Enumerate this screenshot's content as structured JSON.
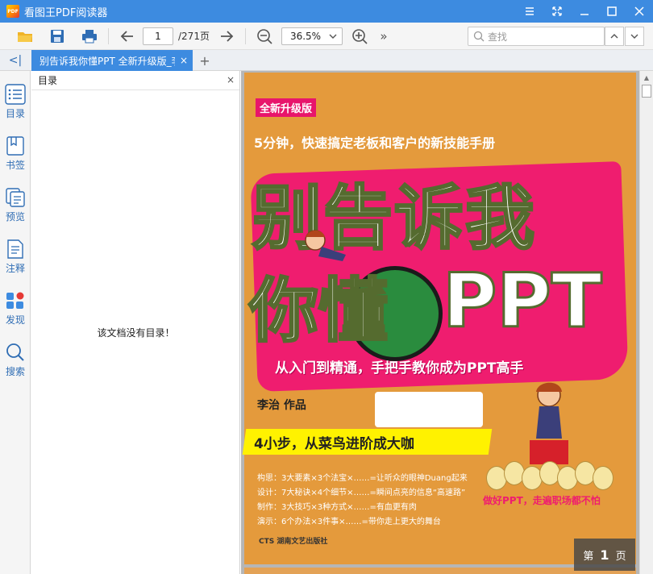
{
  "app": {
    "title": "看图王PDF阅读器",
    "logo_text": "PDF",
    "accent_color": "#3d8be0"
  },
  "window_controls": [
    "menu-icon",
    "fullscreen-icon",
    "minimize-icon",
    "maximize-icon",
    "close-icon"
  ],
  "toolbar": {
    "open_icon": "folder-open-icon",
    "save_icon": "save-icon",
    "print_icon": "print-icon",
    "prev_icon": "arrow-left-icon",
    "current_page": "1",
    "total_pages": "/271页",
    "next_icon": "arrow-right-icon",
    "zoom_value": "36.5%",
    "more_label": "»",
    "search_placeholder": "查找"
  },
  "tabs": {
    "collapse_label": "<|",
    "active_tab_label": "别告诉我你懂PPT 全新升级版_李治",
    "tab_close": "×",
    "new_tab": "+"
  },
  "sidebar": {
    "items": [
      {
        "label": "目录",
        "icon": "outline-list-icon"
      },
      {
        "label": "书签",
        "icon": "bookmark-icon"
      },
      {
        "label": "预览",
        "icon": "thumbnail-preview-icon"
      },
      {
        "label": "注释",
        "icon": "annotation-icon"
      },
      {
        "label": "发现",
        "icon": "discover-apps-icon"
      },
      {
        "label": "搜索",
        "icon": "search-icon"
      }
    ]
  },
  "outline": {
    "title": "目录",
    "close": "×",
    "empty_message": "该文档没有目录！"
  },
  "document": {
    "cover": {
      "edition": "全新升级版",
      "subtitle_top": "5分钟，快速搞定老板和客户的新技能手册",
      "title_line1": "别告诉我",
      "title_line2_a": "你",
      "title_line2_b": "懂",
      "title_line2_c": "PPT",
      "tagline": "从入门到精通，手把手教你成为PPT高手",
      "author": "李治 作品",
      "banner": "4小步，从菜鸟进阶成大咖",
      "bullets": [
        "构思：3大要素×3个法宝×……=让听众的眼神Duang起来",
        "设计：7大秘诀×4个细节×……=瞬间点亮的信息“高速路”",
        "制作：3大技巧×3种方式×……=有血更有肉",
        "演示：6个办法×3件事×……=带你走上更大的舞台"
      ],
      "slogan": "做好PPT，走遍职场都不怕",
      "publisher": "CTS 湖南文艺出版社"
    },
    "page_badge": {
      "prefix": "第",
      "number": "1",
      "suffix": "页"
    }
  }
}
